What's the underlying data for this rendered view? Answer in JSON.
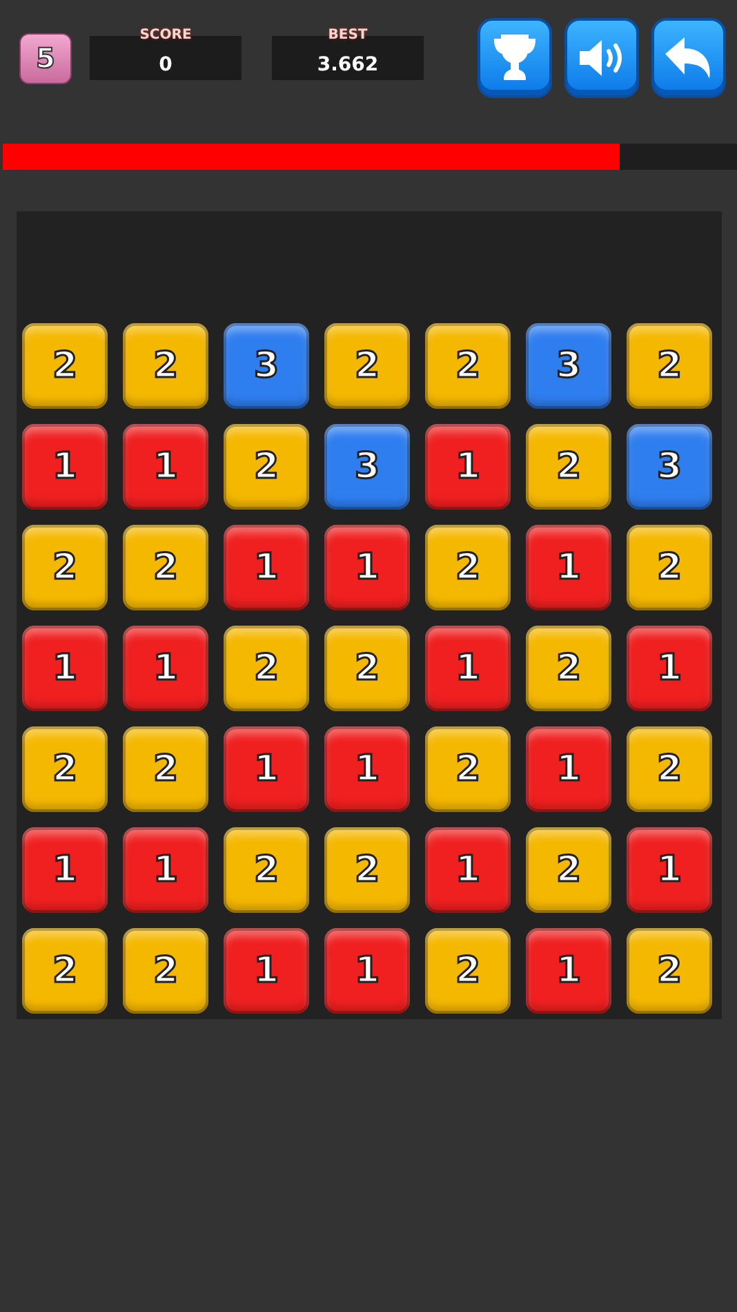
{
  "level_badge": "5",
  "stats": [
    {
      "label": "SCORE",
      "value": "0"
    },
    {
      "label": "BEST",
      "value": "3.662"
    }
  ],
  "buttons": [
    {
      "kind": "trophy"
    },
    {
      "kind": "sound"
    },
    {
      "kind": "back"
    }
  ],
  "timer": {
    "level": 0.84
  },
  "board": [
    [
      {
        "value": "2",
        "color": "#f5b800"
      },
      {
        "value": "2",
        "color": "#f5b800"
      },
      {
        "value": "3",
        "color": "#2f7ef0"
      },
      {
        "value": "2",
        "color": "#f5b800"
      },
      {
        "value": "2",
        "color": "#f5b800"
      },
      {
        "value": "3",
        "color": "#2f7ef0"
      },
      {
        "value": "2",
        "color": "#f5b800"
      }
    ],
    [
      {
        "value": "1",
        "color": "#f02020"
      },
      {
        "value": "1",
        "color": "#f02020"
      },
      {
        "value": "2",
        "color": "#f5b800"
      },
      {
        "value": "3",
        "color": "#2f7ef0"
      },
      {
        "value": "1",
        "color": "#f02020"
      },
      {
        "value": "2",
        "color": "#f5b800"
      },
      {
        "value": "3",
        "color": "#2f7ef0"
      }
    ],
    [
      {
        "value": "2",
        "color": "#f5b800"
      },
      {
        "value": "2",
        "color": "#f5b800"
      },
      {
        "value": "1",
        "color": "#f02020"
      },
      {
        "value": "1",
        "color": "#f02020"
      },
      {
        "value": "2",
        "color": "#f5b800"
      },
      {
        "value": "1",
        "color": "#f02020"
      },
      {
        "value": "2",
        "color": "#f5b800"
      }
    ],
    [
      {
        "value": "1",
        "color": "#f02020"
      },
      {
        "value": "1",
        "color": "#f02020"
      },
      {
        "value": "2",
        "color": "#f5b800"
      },
      {
        "value": "2",
        "color": "#f5b800"
      },
      {
        "value": "1",
        "color": "#f02020"
      },
      {
        "value": "2",
        "color": "#f5b800"
      },
      {
        "value": "1",
        "color": "#f02020"
      }
    ],
    [
      {
        "value": "2",
        "color": "#f5b800"
      },
      {
        "value": "2",
        "color": "#f5b800"
      },
      {
        "value": "1",
        "color": "#f02020"
      },
      {
        "value": "1",
        "color": "#f02020"
      },
      {
        "value": "2",
        "color": "#f5b800"
      },
      {
        "value": "1",
        "color": "#f02020"
      },
      {
        "value": "2",
        "color": "#f5b800"
      }
    ],
    [
      {
        "value": "1",
        "color": "#f02020"
      },
      {
        "value": "1",
        "color": "#f02020"
      },
      {
        "value": "2",
        "color": "#f5b800"
      },
      {
        "value": "2",
        "color": "#f5b800"
      },
      {
        "value": "1",
        "color": "#f02020"
      },
      {
        "value": "2",
        "color": "#f5b800"
      },
      {
        "value": "1",
        "color": "#f02020"
      }
    ],
    [
      {
        "value": "2",
        "color": "#f5b800"
      },
      {
        "value": "2",
        "color": "#f5b800"
      },
      {
        "value": "1",
        "color": "#f02020"
      },
      {
        "value": "1",
        "color": "#f02020"
      },
      {
        "value": "2",
        "color": "#f5b800"
      },
      {
        "value": "1",
        "color": "#f02020"
      },
      {
        "value": "2",
        "color": "#f5b800"
      }
    ]
  ]
}
